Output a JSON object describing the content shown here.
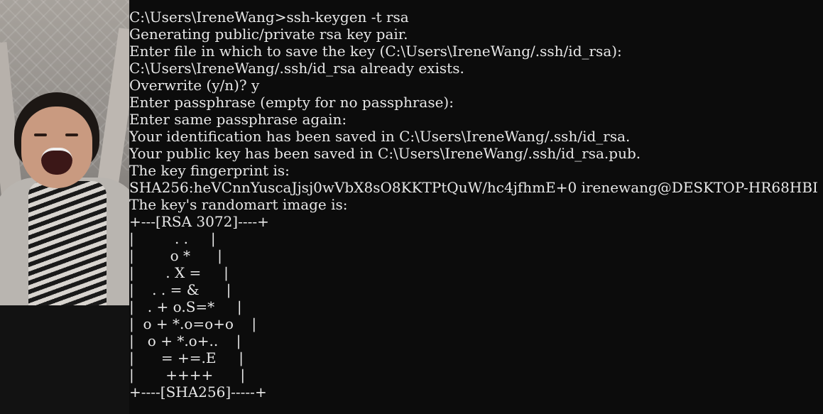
{
  "terminal": {
    "lines": [
      "C:\\Users\\IreneWang>ssh-keygen -t rsa",
      "Generating public/private rsa key pair.",
      "Enter file in which to save the key (C:\\Users\\IreneWang/.ssh/id_rsa):",
      "C:\\Users\\IreneWang/.ssh/id_rsa already exists.",
      "Overwrite (y/n)? y",
      "Enter passphrase (empty for no passphrase):",
      "Enter same passphrase again:",
      "Your identification has been saved in C:\\Users\\IreneWang/.ssh/id_rsa.",
      "Your public key has been saved in C:\\Users\\IreneWang/.ssh/id_rsa.pub.",
      "The key fingerprint is:",
      "SHA256:heVCnnYuscaJjsj0wVbX8sO8KKTPtQuW/hc4jfhmE+0 irenewang@DESKTOP-HR68HBI",
      "The key's randomart image is:",
      "+---[RSA 3072]----+",
      "|         . .     |",
      "|        o *      |",
      "|       . X =     |",
      "|    . . = &      |",
      "|   . + o.S=*     |",
      "|  o + *.o=o+o    |",
      "|   o + *.o+..    |",
      "|      = +=.E     |",
      "|       ++++      |",
      "+----[SHA256]-----+"
    ]
  },
  "photo": {
    "icon": "person-photo"
  },
  "colors": {
    "background": "#0c0c0c",
    "text": "#e8e8e8"
  }
}
